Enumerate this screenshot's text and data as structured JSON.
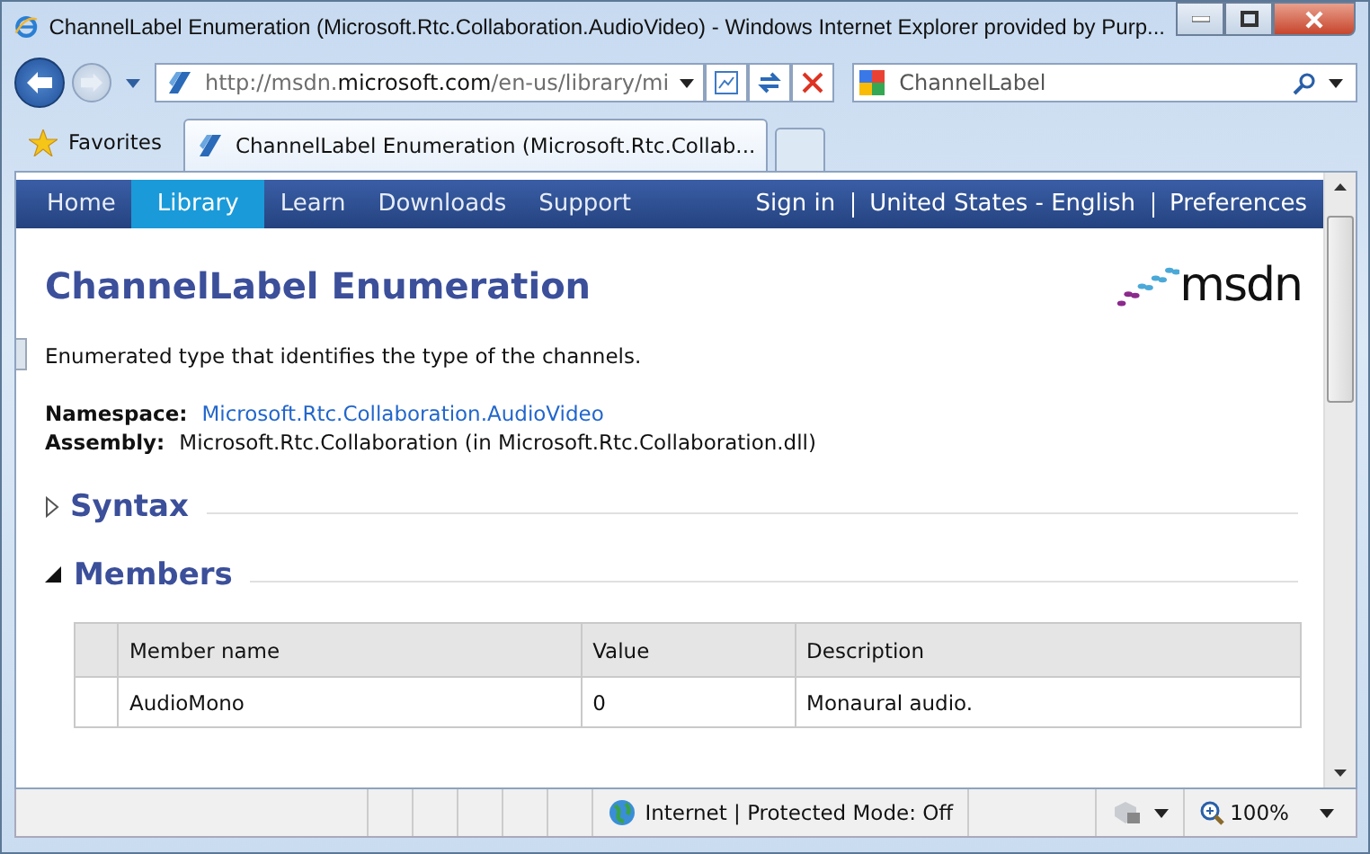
{
  "window": {
    "title": "ChannelLabel Enumeration (Microsoft.Rtc.Collaboration.AudioVideo) - Windows Internet Explorer provided by Purp..."
  },
  "address_bar": {
    "url_parts": [
      {
        "text": "http://msdn.",
        "emphasis": false
      },
      {
        "text": "microsoft.com",
        "emphasis": true
      },
      {
        "text": "/en-us/library/mi",
        "emphasis": false
      }
    ]
  },
  "search": {
    "value": "ChannelLabel"
  },
  "favorites": {
    "label": "Favorites"
  },
  "tabs": [
    {
      "label": "ChannelLabel Enumeration (Microsoft.Rtc.Collab...",
      "selected": true
    }
  ],
  "site_nav": {
    "items": [
      {
        "label": "Home",
        "selected": false
      },
      {
        "label": "Library",
        "selected": true
      },
      {
        "label": "Learn",
        "selected": false
      },
      {
        "label": "Downloads",
        "selected": false
      },
      {
        "label": "Support",
        "selected": false
      }
    ],
    "links": [
      "Sign in",
      "United States - English",
      "Preferences"
    ]
  },
  "page": {
    "title": "ChannelLabel Enumeration",
    "logo": "msdn",
    "summary": "Enumerated type that identifies the type of the channels.",
    "namespace": {
      "label": "Namespace:",
      "value": "Microsoft.Rtc.Collaboration.AudioVideo"
    },
    "assembly": {
      "label": "Assembly:",
      "value": "Microsoft.Rtc.Collaboration (in Microsoft.Rtc.Collaboration.dll)"
    },
    "sections": [
      {
        "title": "Syntax",
        "expanded": false
      },
      {
        "title": "Members",
        "expanded": true
      }
    ],
    "table": {
      "columns": [
        "Member name",
        "Value",
        "Description"
      ],
      "rows": [
        [
          "AudioMono",
          "0",
          "Monaural audio."
        ]
      ]
    }
  },
  "status_bar": {
    "zone": "Internet | Protected Mode: Off",
    "zoom": "100%"
  }
}
